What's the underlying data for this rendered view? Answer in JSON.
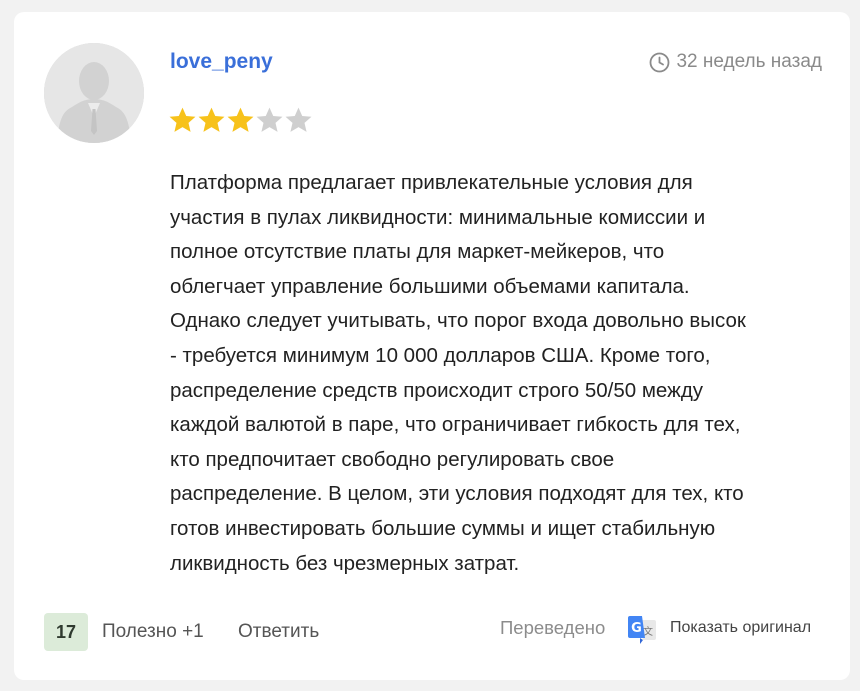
{
  "review": {
    "username": "love_peny",
    "time_ago": "32 недель назад",
    "rating": 3,
    "rating_max": 5,
    "star_color_filled": "#f7c21b",
    "star_color_empty": "#cfcfcf",
    "text": "Платформа предлагает привлекательные условия для участия в пулах ликвидности: минимальные комиссии и полное отсутствие платы для маркет-мейкеров, что облегчает управление большими объемами капитала. Однако следует учитывать, что порог входа довольно высок - требуется минимум 10 000 долларов США. Кроме того, распределение средств происходит строго 50/50 между каждой валютой в паре, что ограничивает гибкость для тех, кто предпочитает свободно регулировать свое распределение. В целом, эти условия подходят для тех, кто готов инвестировать большие суммы и ищет стабильную ликвидность без чрезмерных затрат.",
    "lines": [
      "Платформа предлагает привлекательные условия для",
      "участия в пулах ликвидности: минимальные комиссии и",
      "полное отсутствие платы для маркет-мейкеров, что",
      "облегчает управление большими объемами капитала.",
      "Однако следует учитывать, что порог входа довольно высок",
      "- требуется минимум 10 000 долларов США. Кроме того,",
      "распределение средств происходит строго 50/50 между",
      "каждой валютой в паре, что ограничивает гибкость для тех,",
      "кто предпочитает свободно регулировать свое",
      "распределение. В целом, эти условия подходят для тех, кто",
      "готов инвестировать большие суммы и ищет стабильную",
      "ликвидность без чрезмерных затрат."
    ]
  },
  "footer": {
    "helpful_count": "17",
    "helpful_label": "Полезно +1",
    "reply_label": "Ответить",
    "translated_label": "Переведено",
    "show_original_label": "Показать оригинал"
  },
  "icons": {
    "avatar": "default-user-avatar",
    "clock": "clock-icon",
    "translate": "google-translate-icon"
  }
}
